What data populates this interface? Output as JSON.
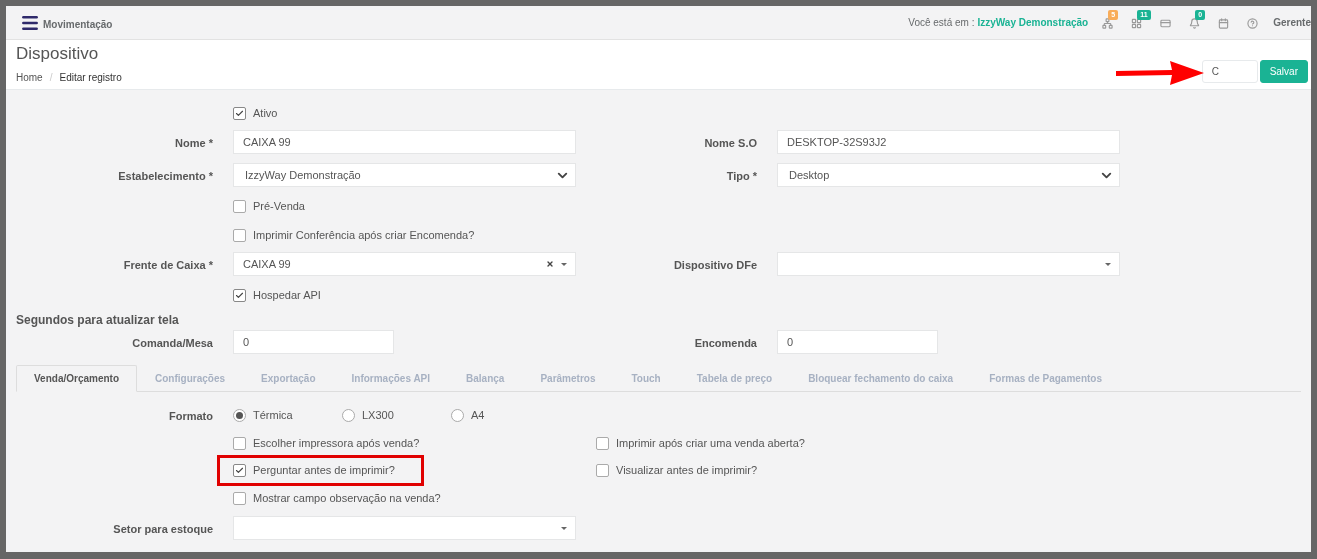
{
  "header": {
    "menu_title": "Movimentação",
    "location_label": "Você está em :",
    "location": "IzzyWay Demonstração",
    "icons": [
      {
        "kind": "sitemap",
        "badge": "5",
        "color": "#f8ac59"
      },
      {
        "kind": "grid",
        "badge": "11",
        "color": "#1ab394"
      },
      {
        "kind": "card"
      },
      {
        "kind": "bell",
        "badge": "0",
        "color": "#1ab394"
      },
      {
        "kind": "calendar"
      },
      {
        "kind": "help"
      }
    ],
    "user": "Gerente"
  },
  "page": {
    "title": "Dispositivo",
    "breadcrumb": [
      "Home",
      "Editar registro"
    ],
    "breadcrumb_separator": "/",
    "buttons": [
      {
        "kind": "cancel",
        "label": "C"
      },
      {
        "kind": "primary",
        "label": "Salvar"
      }
    ],
    "arrow_annotation": true
  },
  "form": [
    {
      "kind": "checkbox",
      "label": "Ativo",
      "checked": true
    },
    {
      "kind": "fields",
      "left": {
        "label": "Nome *",
        "kind": "text",
        "value": "CAIXA 99"
      },
      "right": {
        "label": "Nome S.O",
        "kind": "text",
        "value": "DESKTOP-32S93J2"
      }
    },
    {
      "kind": "fields",
      "left": {
        "label": "Estabelecimento *",
        "kind": "select",
        "value": "IzzyWay Demonstração"
      },
      "right": {
        "label": "Tipo *",
        "kind": "select",
        "value": "Desktop"
      }
    },
    {
      "kind": "checkbox",
      "label": "Pré-Venda",
      "checked": false
    },
    {
      "kind": "checkbox",
      "label": "Imprimir Conferência após criar Encomenda?",
      "checked": false
    },
    {
      "kind": "fields",
      "left": {
        "label": "Frente de Caixa *",
        "kind": "combo",
        "value": "CAIXA 99",
        "clearable": true
      },
      "right": {
        "label": "Dispositivo DFe",
        "kind": "combo",
        "clearable": false
      }
    },
    {
      "kind": "checkbox",
      "label": "Hospedar API",
      "checked": true
    },
    {
      "kind": "heading",
      "label": "Segundos para atualizar tela"
    },
    {
      "kind": "fields",
      "left": {
        "label": "Comanda/Mesa",
        "kind": "short",
        "value": "0"
      },
      "right": {
        "label": "Encomenda",
        "kind": "short",
        "value": "0"
      }
    }
  ],
  "tabs": [
    {
      "label": "Venda/Orçamento",
      "selected": true
    },
    {
      "label": "Configurações",
      "selected": false
    },
    {
      "label": "Exportação",
      "selected": false
    },
    {
      "label": "Informações API",
      "selected": false
    },
    {
      "label": "Balança",
      "selected": false
    },
    {
      "label": "Parâmetros",
      "selected": false
    },
    {
      "label": "Touch",
      "selected": false
    },
    {
      "label": "Tabela de preço",
      "selected": false
    },
    {
      "label": "Bloquear fechamento do caixa",
      "selected": false
    },
    {
      "label": "Formas de Pagamentos",
      "selected": false
    }
  ],
  "tab_content": {
    "format": {
      "label": "Formato",
      "options": [
        {
          "label": "Térmica",
          "selected": true
        },
        {
          "label": "LX300",
          "selected": false
        },
        {
          "label": "A4",
          "selected": false
        }
      ]
    },
    "checks": [
      {
        "left": {
          "label": "Escolher impressora após venda?",
          "checked": false,
          "highlighted": false
        },
        "right": {
          "label": "Imprimir após criar uma venda aberta?",
          "checked": false,
          "highlighted": false
        }
      },
      {
        "left": {
          "label": "Perguntar antes de imprimir?",
          "checked": true,
          "highlighted": true
        },
        "right": {
          "label": "Visualizar antes de imprimir?",
          "checked": false,
          "highlighted": false
        }
      },
      {
        "left": {
          "label": "Mostrar campo observação na venda?",
          "checked": false,
          "highlighted": false
        }
      }
    ],
    "stock": {
      "label": "Setor para estoque"
    }
  }
}
